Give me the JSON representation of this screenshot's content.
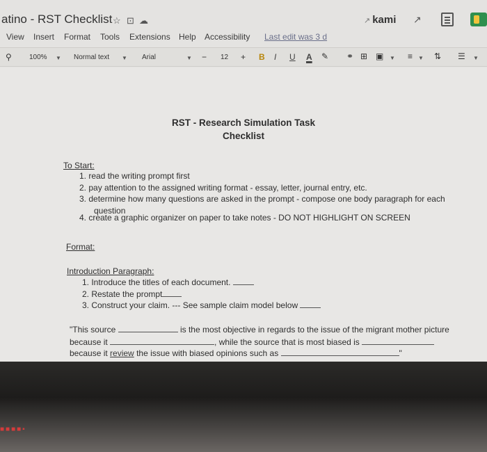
{
  "header": {
    "doc_title": "atino - RST Checklist",
    "kami_label": "kami",
    "star_icon": "☆",
    "folder_icon": "⊡",
    "cloud_icon": "☁"
  },
  "menu": {
    "items": [
      "View",
      "Insert",
      "Format",
      "Tools",
      "Extensions",
      "Help",
      "Accessibility"
    ],
    "last_edit": "Last edit was 3 d"
  },
  "toolbar": {
    "zoom": "100%",
    "style": "Normal text",
    "font": "Arial",
    "minus": "−",
    "font_size": "12",
    "plus": "+",
    "bold": "B",
    "italic": "I",
    "underline": "U",
    "text_color": "A"
  },
  "document": {
    "title_line1": "RST - Research Simulation Task",
    "title_line2": "Checklist",
    "to_start_heading": "To Start:",
    "to_start_items": [
      "1.  read the writing prompt first",
      "2.  pay attention to the assigned writing format - essay, letter, journal entry, etc.",
      "3.  determine how many questions are asked in the prompt - compose one body paragraph for each",
      "question",
      "4.  create a graphic organizer on paper to take notes - DO NOT HIGHLIGHT ON SCREEN"
    ],
    "format_heading": "Format:",
    "intro_heading": "Introduction Paragraph:",
    "intro_items": [
      "1.  Introduce the titles of each document.",
      "2.  Restate the prompt",
      "3.  Construct your claim. --- See sample claim model below"
    ],
    "claim": {
      "part1": "\"This source",
      "part2": "is the most objective in regards to the issue of the migrant mother picture",
      "part3": "because it",
      "part4": ", while the source that is most biased is",
      "part5": "because it",
      "link": "review",
      "part6": "the issue with biased opinions such as",
      "quote_end": "\""
    }
  }
}
